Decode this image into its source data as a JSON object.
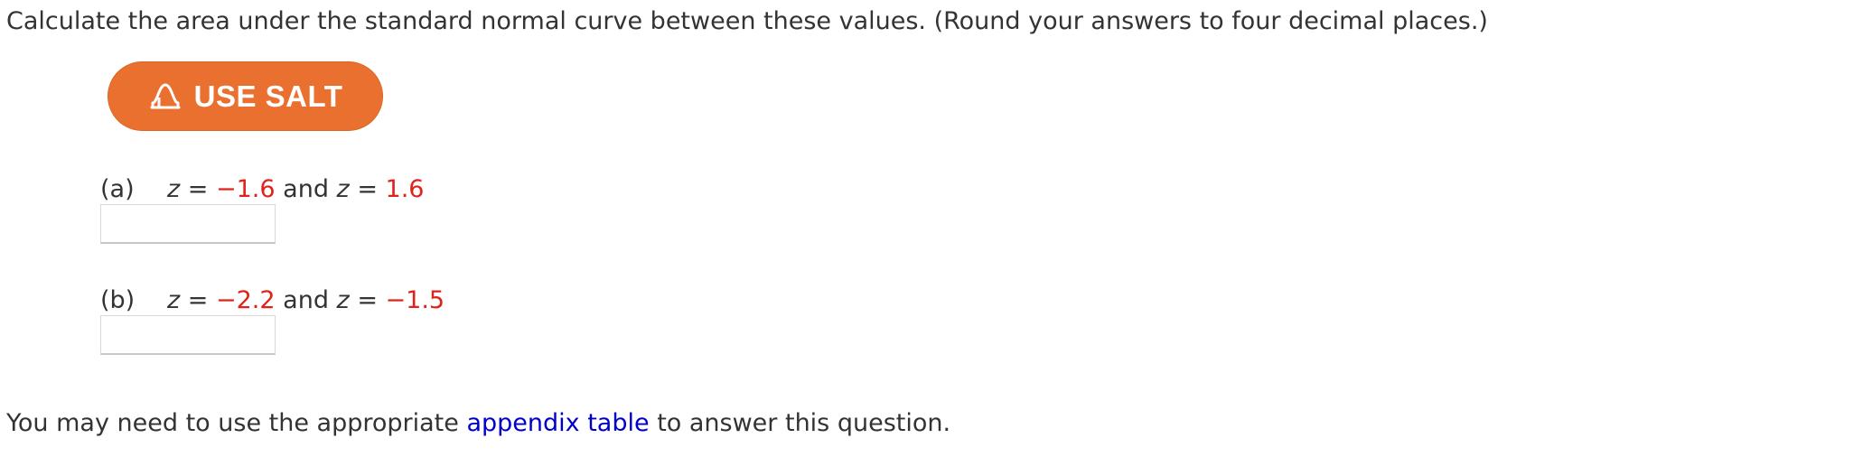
{
  "question": {
    "instruction": "Calculate the area under the standard normal curve between these values. (Round your answers to four decimal places.)"
  },
  "salt_button": {
    "label": "USE SALT",
    "icon": "normal-curve-icon",
    "color": "#ea7030"
  },
  "parts": [
    {
      "letter": "(a)",
      "var1": "z",
      "eq1": "=",
      "value1": "−1.6",
      "conj": "and",
      "var2": "z",
      "eq2": "=",
      "value2": "1.6",
      "answer": ""
    },
    {
      "letter": "(b)",
      "var1": "z",
      "eq1": "=",
      "value1": "−2.2",
      "conj": "and",
      "var2": "z",
      "eq2": "=",
      "value2": "−1.5",
      "answer": ""
    }
  ],
  "footer": {
    "before": "You may need to use the appropriate ",
    "link": "appendix table",
    "after": " to answer this question."
  },
  "colors": {
    "highlight": "#e0221b",
    "link": "#0000cc"
  }
}
